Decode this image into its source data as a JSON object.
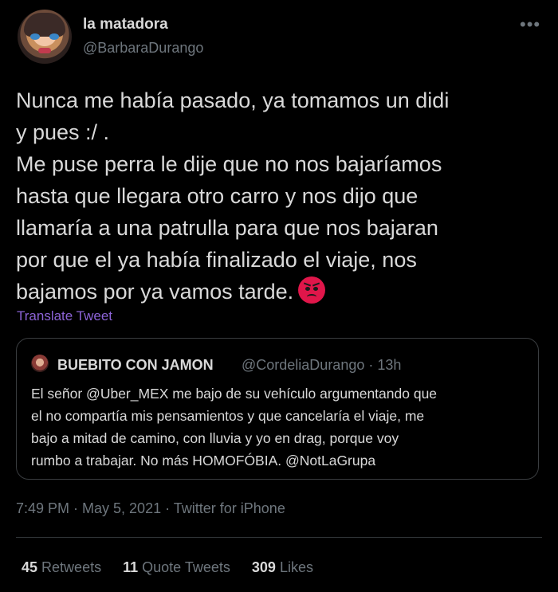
{
  "author": {
    "display_name": "la matadora",
    "handle": "@BarbaraDurango"
  },
  "more_icon": "more-horizontal-icon",
  "tweet": {
    "lines": [
      "Nunca me había pasado, ya tomamos un didi",
      "y pues :/ .",
      "Me puse perra le dije que no nos bajaríamos",
      "hasta que llegara otro carro y nos dijo que",
      "llamaría a una patrulla para que nos bajaran",
      "por que el ya había finalizado el viaje, nos",
      "bajamos por ya vamos tarde."
    ],
    "emoji": "angry-face-icon",
    "translate_label": "Translate Tweet"
  },
  "quote": {
    "display_name": "BUEBITO CON JAMON",
    "meta": "@CordeliaDurango · 13h",
    "lines": [
      "El señor @Uber_MEX me bajo de su vehículo argumentando que",
      "el no compartía mis pensamientos y que cancelaría el viaje, me",
      "bajo a mitad de camino, con lluvia y yo en drag, porque voy",
      "rumbo a trabajar. No más HOMOFÓBIA. @NotLaGrupa"
    ]
  },
  "meta": "7:49 PM · May 5, 2021 · Twitter for iPhone",
  "stats": {
    "retweets_count": "45",
    "retweets_label": "Retweets",
    "quotes_count": "11",
    "quotes_label": "Quote Tweets",
    "likes_count": "309",
    "likes_label": "Likes"
  },
  "colors": {
    "background": "#000000",
    "text": "#d9d9d9",
    "secondary": "#6e767d",
    "translate": "#8c63d6",
    "border": "#2f3336"
  }
}
